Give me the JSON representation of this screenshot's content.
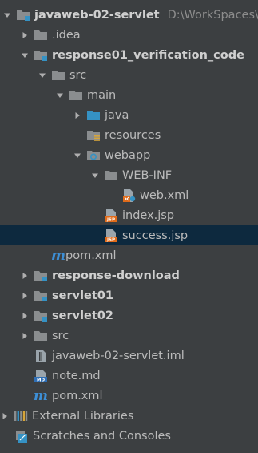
{
  "tree": {
    "root": {
      "name": "javaweb-02-servlet",
      "path": "D:\\WorkSpaces\\Io"
    },
    "idea": ".idea",
    "response01": "response01_verification_code",
    "src": "src",
    "main": "main",
    "java": "java",
    "resources": "resources",
    "webapp": "webapp",
    "webinf": "WEB-INF",
    "webxml": "web.xml",
    "indexjsp": "index.jsp",
    "successjsp": "success.jsp",
    "pom_inner": "pom.xml",
    "response_download": "response-download",
    "servlet01": "servlet01",
    "servlet02": "servlet02",
    "src_root": "src",
    "iml": "javaweb-02-servlet.iml",
    "note": "note.md",
    "pom_root": "pom.xml",
    "external": "External Libraries",
    "scratches": "Scratches and Consoles"
  },
  "icons": {
    "jsp_badge": "JSP",
    "md_badge": "MD",
    "maven_glyph": "m"
  },
  "colors": {
    "background": "#3c3f41",
    "selection": "#0d293e",
    "text": "#bbbbbb",
    "folder": "#8a8d8f",
    "source_folder": "#3592c4",
    "jsp": "#e06b1a"
  }
}
